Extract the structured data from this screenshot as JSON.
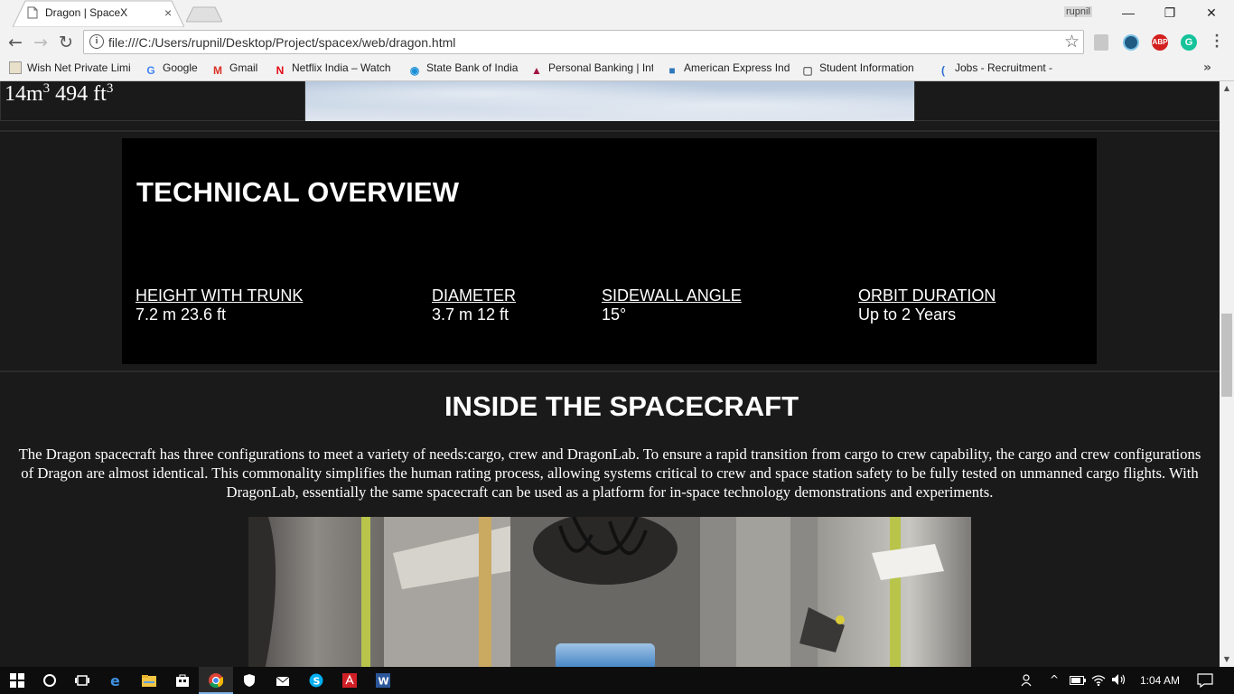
{
  "browser": {
    "tab": {
      "title": "Dragon | SpaceX",
      "close_glyph": "×"
    },
    "profile_name": "rupnil",
    "window_buttons": {
      "minimize": "—",
      "restore": "❐",
      "close": "✕"
    },
    "nav": {
      "back": "←",
      "forward": "→",
      "reload": "↻"
    },
    "address": {
      "url": "file:///C:/Users/rupnil/Desktop/Project/spacex/web/dragon.html",
      "info_glyph": "i",
      "star_glyph": "☆"
    },
    "extensions": {
      "abp": "ABP",
      "grammarly": "G"
    },
    "bookmarks": [
      {
        "label": "Wish Net Private Limi",
        "icon": "wishnet-icon"
      },
      {
        "label": "Google",
        "icon": "google-icon",
        "glyph": "G",
        "color": "#4285f4"
      },
      {
        "label": "Gmail",
        "icon": "gmail-icon",
        "glyph": "M",
        "color": "#d93025"
      },
      {
        "label": "Netflix India – Watch",
        "icon": "netflix-icon",
        "glyph": "N",
        "color": "#e50914"
      },
      {
        "label": "State Bank of India",
        "icon": "sbi-icon",
        "glyph": "◉",
        "color": "#1a8fd8"
      },
      {
        "label": "Personal Banking | Int",
        "icon": "axis-bank-icon",
        "glyph": "▲",
        "color": "#a0153e"
      },
      {
        "label": "American Express Ind",
        "icon": "amex-icon",
        "glyph": "■",
        "color": "#2e77bb"
      },
      {
        "label": "Student Information",
        "icon": "page-icon",
        "glyph": "▢",
        "color": "#666666"
      },
      {
        "label": "Jobs - Recruitment -",
        "icon": "jobs-icon",
        "glyph": "(",
        "color": "#2b6bd1"
      }
    ],
    "bookmarks_more": "»"
  },
  "page": {
    "capacity": {
      "value_m": "14m",
      "sup_m": "3",
      "value_ft": " 494 ft",
      "sup_ft": "3"
    },
    "technical_overview": {
      "title": "TECHNICAL OVERVIEW",
      "specs": [
        {
          "label": "HEIGHT WITH TRUNK",
          "value": "7.2 m 23.6 ft"
        },
        {
          "label": "DIAMETER",
          "value": "3.7 m 12 ft"
        },
        {
          "label": "SIDEWALL ANGLE",
          "value": "15°"
        },
        {
          "label": "ORBIT DURATION",
          "value": "Up to 2 Years"
        }
      ]
    },
    "inside": {
      "title": "INSIDE THE SPACECRAFT",
      "text": "The Dragon spacecraft has three configurations to meet a variety of needs:cargo, crew and DragonLab. To ensure a rapid transition from cargo to crew capability, the cargo and crew configurations of Dragon are almost identical. This commonality simplifies the human rating process, allowing systems critical to crew and space station safety to be fully tested on unmanned cargo flights. With DragonLab, essentially the same spacecraft can be used as a platform for in-space technology demonstrations and experiments."
    }
  },
  "scrollbar": {
    "up_glyph": "▲",
    "down_glyph": "▼",
    "position_fraction": 0.46
  },
  "taskbar": {
    "clock": "1:04 AM",
    "tray": {
      "chevron": "^"
    },
    "apps": [
      "start-icon",
      "search-icon",
      "task-view-icon",
      "edge-icon",
      "file-explorer-icon",
      "store-icon",
      "chrome-icon",
      "defender-icon",
      "mail-icon",
      "skype-icon",
      "acrobat-icon",
      "word-icon"
    ]
  }
}
